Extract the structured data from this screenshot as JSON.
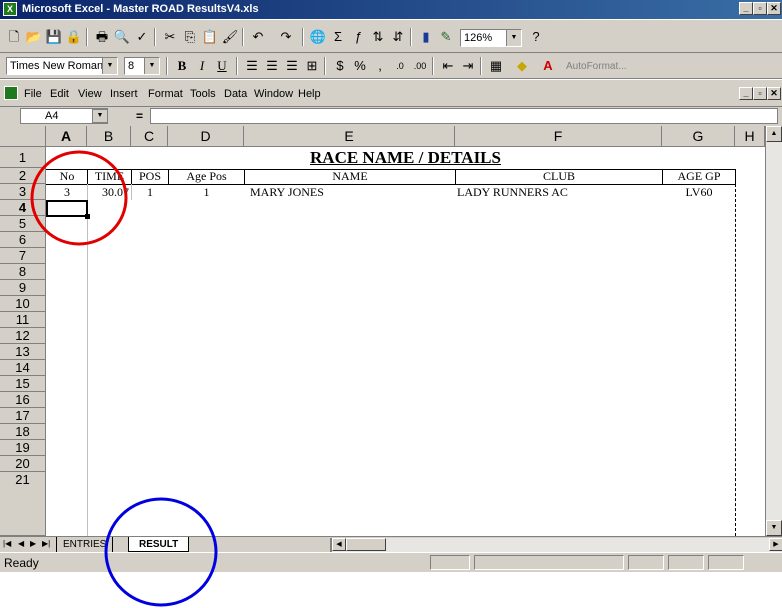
{
  "window": {
    "title": "Microsoft Excel - Master ROAD ResultsV4.xls",
    "min_glyph": "_",
    "max_glyph": "▫",
    "close_glyph": "✕"
  },
  "toolbar": {
    "zoom": "126%",
    "font_name": "Times New Roman",
    "font_size": "8",
    "bold": "B",
    "italic": "I",
    "underline": "U",
    "autoformat": "AutoFormat..."
  },
  "menu": [
    "File",
    "Edit",
    "View",
    "Insert",
    "Format",
    "Tools",
    "Data",
    "Window",
    "Help"
  ],
  "formula_bar": {
    "name_box": "A4",
    "equals": "="
  },
  "columns": [
    "A",
    "B",
    "C",
    "D",
    "E",
    "F",
    "G",
    "H"
  ],
  "rows": [
    "1",
    "2",
    "3",
    "4",
    "5",
    "6",
    "7",
    "8",
    "9",
    "10",
    "11",
    "12",
    "13",
    "14",
    "15",
    "16",
    "17",
    "18",
    "19",
    "20",
    "21"
  ],
  "sheet": {
    "title": "RACE NAME / DETAILS",
    "headers": [
      "No",
      "TIME",
      "POS",
      "Age Pos",
      "NAME",
      "CLUB",
      "AGE GP"
    ],
    "data_row": [
      "3",
      "30.07",
      "1",
      "1",
      "MARY JONES",
      "LADY RUNNERS AC",
      "LV60"
    ]
  },
  "tabs": [
    "ENTRIES",
    "RESULT"
  ],
  "status": "Ready",
  "annotations": {
    "red": "#e00000",
    "blue": "#0000e0"
  }
}
